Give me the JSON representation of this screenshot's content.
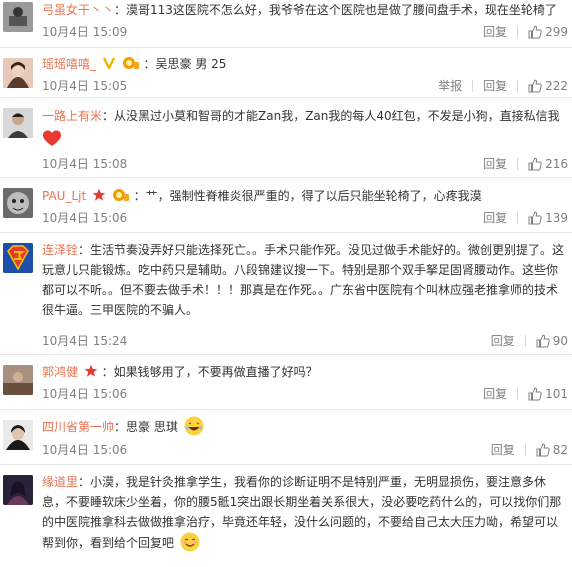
{
  "actions": {
    "reply": "回复",
    "report": "举报",
    "like_icon": "thumbs-up-icon"
  },
  "comments": [
    {
      "user": "弓虽女干丶丶",
      "text": "：漠哥113这医院不怎么好，我爷爷在这个医院也是做了腰间盘手术，现在坐轮椅了",
      "time": "10月4日 15:09",
      "likes": "299",
      "avatar_color": "#7a7a7a"
    },
    {
      "user": "瑶瑶嘻嘻_",
      "text": "：吴思豪 男 25",
      "time": "10月4日 15:05",
      "likes": "222",
      "avatar_color": "#c9a08a",
      "badges": [
        "vip-v-icon",
        "member-icon"
      ]
    },
    {
      "user": "一路上有米",
      "text": "：从没黑过小莫和智哥的才能Zan我，Zan我的每人40红包，不发是小狗，直接私信我",
      "time": "10月4日 15:08",
      "likes": "216",
      "avatar_color": "#4a4a4a",
      "emoji": "heart-emoji"
    },
    {
      "user": "PAU_Ljt",
      "text": "：艹，强制性脊椎炎很严重的，得了以后只能坐轮椅了，心疼我漠",
      "time": "10月4日 15:06",
      "likes": "139",
      "avatar_color": "#5c5c5c",
      "badges": [
        "star-icon",
        "member-icon"
      ]
    },
    {
      "user": "连泽铨",
      "text": "：生活节奏没弄好只能选择死亡。。手术只能作死。没见过做手术能好的。微创更别提了。这玩意儿只能锻炼。吃中药只是辅助。八段锦建议搜一下。特别是那个双手拏足固肾腰动作。这些你都可以不听。。但不要去做手术！！！那真是在作死。。广东省中医院有个叫林应强老推拿师的技术很牛逼。三甲医院的不骗人。",
      "time": "10月4日 15:24",
      "likes": "90",
      "avatar_color": "#1d4fa8"
    },
    {
      "user": "郭鸿健",
      "text": "：如果钱够用了，不要再做直播了好吗？",
      "time": "10月4日 15:06",
      "likes": "101",
      "avatar_color": "#8a7060",
      "badges": [
        "star-icon"
      ]
    },
    {
      "user": "四川省第一帅",
      "text": "：思豪 思琪",
      "time": "10月4日 15:06",
      "likes": "82",
      "avatar_color": "#2b2b2b",
      "emoji": "laughing-emoji"
    },
    {
      "user": "缘道里",
      "text": "：小漠，我是针灸推拿学生，我看你的诊断证明不是特别严重，无明显损伤，要注意多休息，不要睡软床少坐着，你的腰5骶1突出跟长期坐着关系很大，没必要吃药什么的，可以找你们那的中医院推拿科去做做推拿治疗，毕竟还年轻，没什么问题的，不要给自己太大压力呦，希望可以帮到你，看到给个回复吧",
      "time": "",
      "likes": "",
      "avatar_color": "#3a2f4a",
      "emoji": "smile-emoji"
    }
  ]
}
